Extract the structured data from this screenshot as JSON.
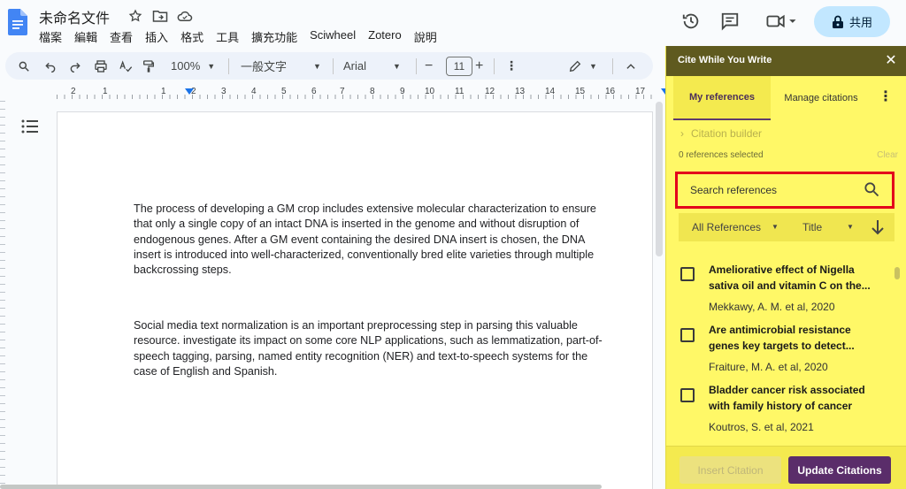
{
  "header": {
    "doc_title": "未命名文件",
    "menu": [
      "檔案",
      "編輯",
      "查看",
      "插入",
      "格式",
      "工具",
      "擴充功能",
      "Sciwheel",
      "Zotero",
      "說明"
    ],
    "share_label": "共用"
  },
  "toolbar": {
    "zoom": "100%",
    "style": "一般文字",
    "font": "Arial",
    "font_size": "11"
  },
  "ruler": {
    "numbers": [
      "2",
      "1",
      "1",
      "2",
      "3",
      "4",
      "5",
      "6",
      "7",
      "8",
      "9",
      "10",
      "11",
      "12",
      "13",
      "14",
      "15",
      "16",
      "17"
    ]
  },
  "document": {
    "paragraphs": [
      "The process of developing a GM crop includes extensive molecular characterization to ensure that only a single copy of an intact DNA is inserted in the genome and without disruption of endogenous genes. After a GM event containing the desired DNA insert is chosen, the DNA insert is introduced into well-characterized, conventionally bred elite varieties through multiple backcrossing steps.",
      "Social media text normalization is an important preprocessing step in parsing this valuable resource. investigate its impact on some core NLP applications, such as lemmatization, part-of-speech tagging, parsing, named entity recognition (NER) and text-to-speech systems for the case of English and Spanish."
    ]
  },
  "panel": {
    "title": "Cite While You Write",
    "tabs": {
      "active": "My references",
      "other": "Manage citations"
    },
    "citation_builder": "Citation builder",
    "selected_count": "0 references selected",
    "clear": "Clear",
    "search_placeholder": "Search references",
    "filter_all": "All References",
    "filter_sort": "Title",
    "references": [
      {
        "title": "Ameliorative effect of Nigella sativa oil and vitamin C on the...",
        "author": "Mekkawy, A. M. et al, 2020"
      },
      {
        "title": "Are antimicrobial resistance genes key targets to detect...",
        "author": "Fraiture, M. A. et al, 2020"
      },
      {
        "title": "Bladder cancer risk associated with family history of cancer",
        "author": "Koutros, S. et al, 2021"
      }
    ],
    "insert_label": "Insert Citation",
    "update_label": "Update Citations"
  },
  "colors": {
    "panel_bg": "#fff867",
    "panel_header": "#5f5a1f",
    "accent_purple": "#5a2d6a",
    "highlight_red": "#e3001b",
    "share_bg": "#c2e7ff"
  }
}
